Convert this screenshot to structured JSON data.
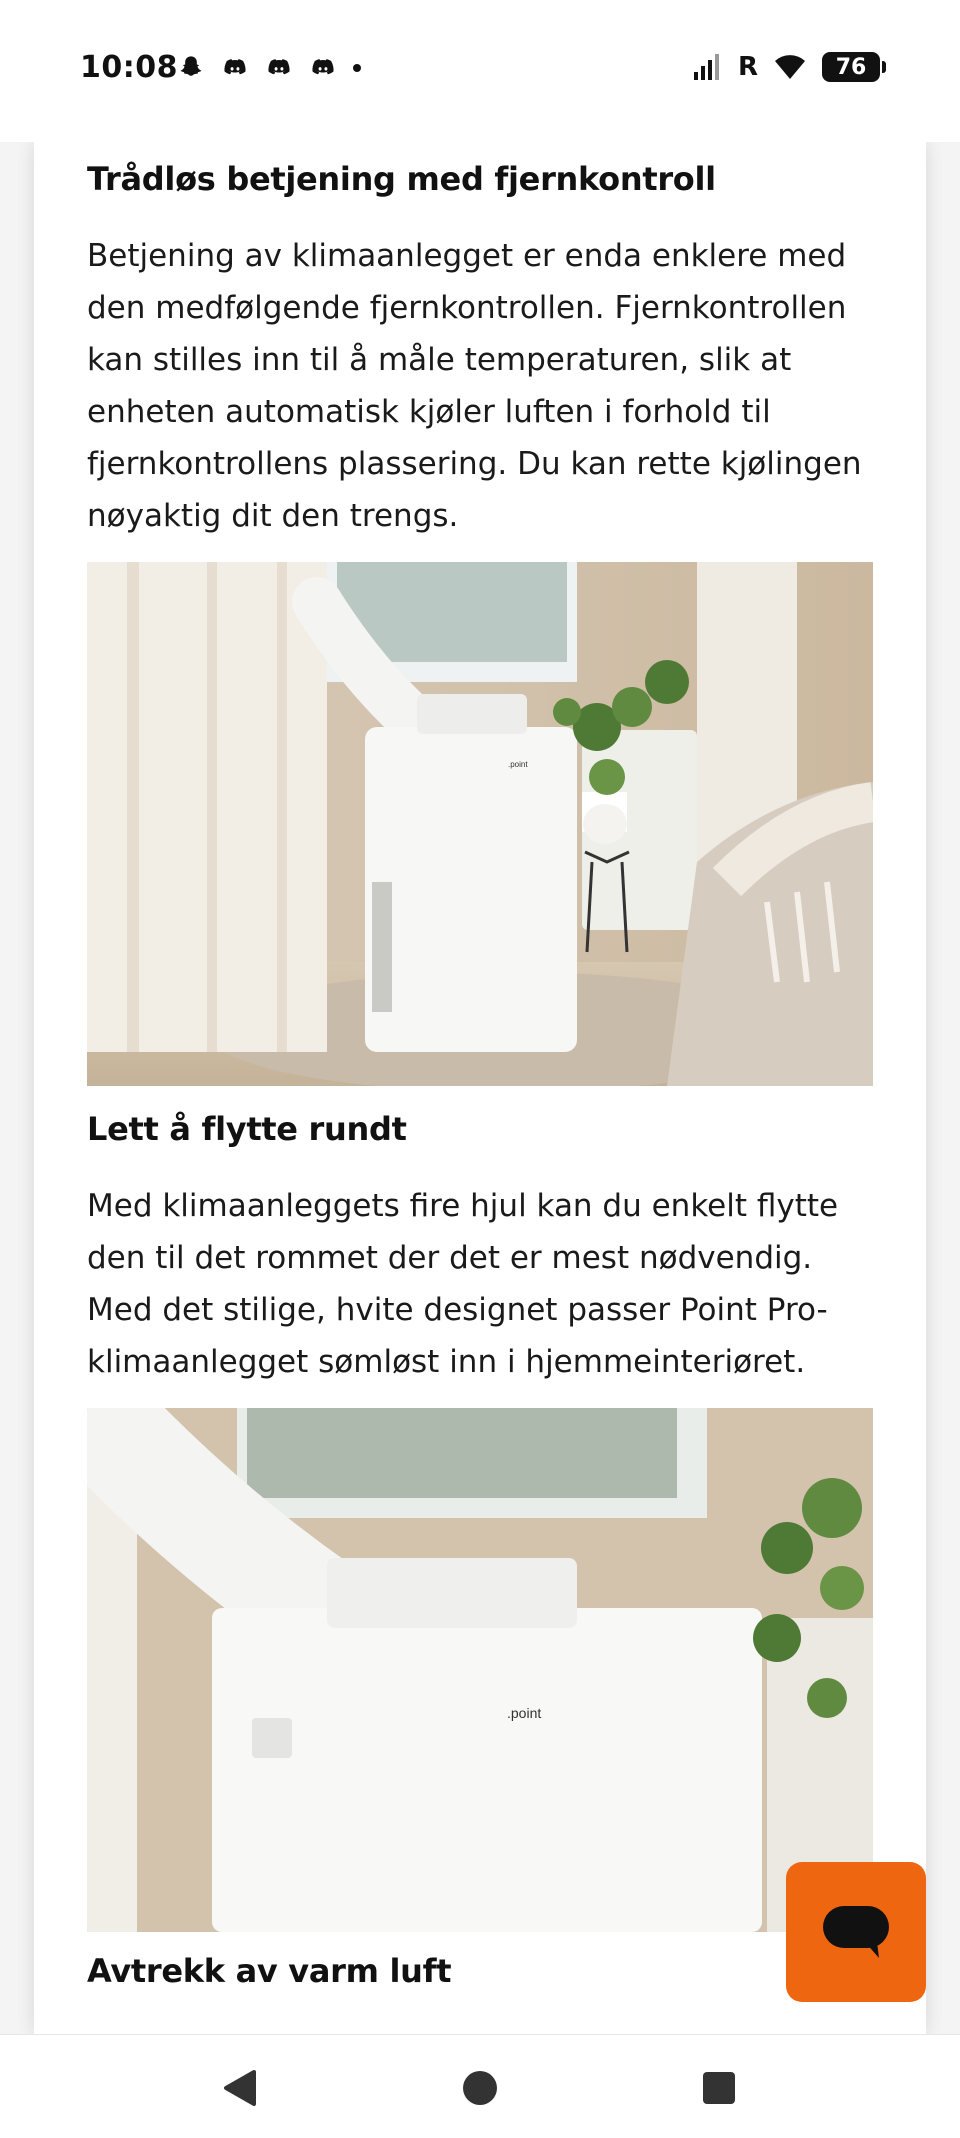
{
  "status_bar": {
    "time": "10:08",
    "notification_icons": [
      "snapchat-icon",
      "discord-icon",
      "discord-icon",
      "discord-icon",
      "dot-icon"
    ],
    "signal_text": "R",
    "battery_percent": "76"
  },
  "article": {
    "sections": [
      {
        "title": "Trådløs betjening med fjernkontroll",
        "body": "Betjening av klimaanlegget er enda enklere med den medfølgende fjernkontrollen. Fjernkontrollen kan stilles inn til å måle temperaturen, slik at enheten automatisk kjøler luften i forhold til fjernkontrollens plassering. Du kan rette kjølingen nøyaktig dit den trengs."
      },
      {
        "title": "Lett å flytte rundt",
        "body": "Med klimaanleggets fire hjul kan du enkelt flytte den til det rommet der det er mest nødvendig. Med det stilige, hvite designet passer Point Pro-klimaanlegget sømløst inn i hjemmeinteriøret."
      },
      {
        "title": "Avtrekk av varm luft"
      }
    ],
    "images": [
      {
        "brand_label": ".point"
      },
      {
        "brand_label": ".point"
      }
    ]
  },
  "chat_button": {
    "icon": "chat-bubble-icon",
    "color": "#ef6611"
  },
  "nav_bar": {
    "icons": [
      "back-icon",
      "home-icon",
      "recents-icon"
    ]
  }
}
